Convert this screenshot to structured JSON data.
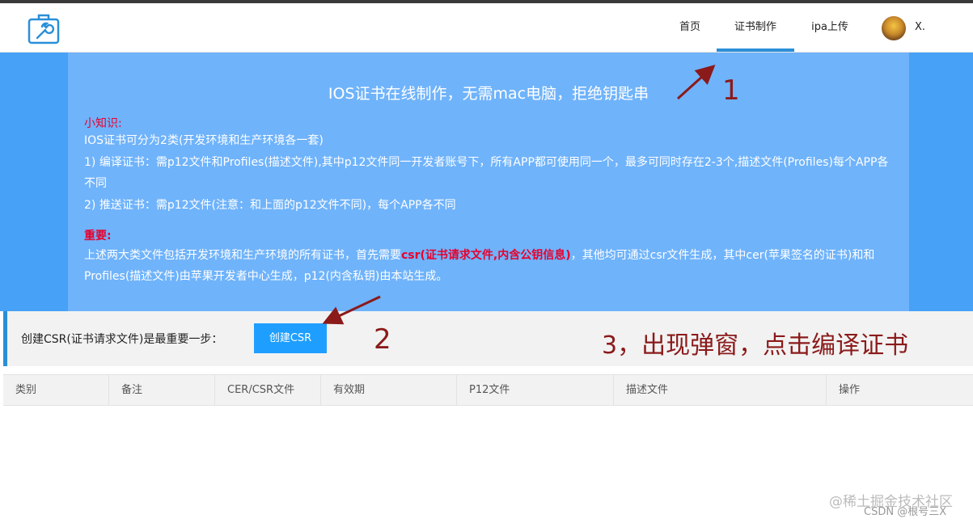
{
  "nav": {
    "logo_icon": "toolbox-wrench-icon",
    "items": [
      {
        "label": "首页",
        "active": false
      },
      {
        "label": "证书制作",
        "active": true
      },
      {
        "label": "ipa上传",
        "active": false
      }
    ],
    "user_name": "X.",
    "accent_color": "#2a8fd8"
  },
  "hero": {
    "title": "IOS证书在线制作，无需mac电脑，拒绝钥匙串",
    "tip_title": "小知识:",
    "tip_lines": [
      "IOS证书可分为2类(开发环境和生产环境各一套)",
      "1) 编译证书：需p12文件和Profiles(描述文件),其中p12文件同一开发者账号下，所有APP都可使用同一个，最多可同时存在2-3个,描述文件(Profiles)每个APP各不同",
      "2) 推送证书：需p12文件(注意：和上面的p12文件不同)，每个APP各不同"
    ],
    "important_title": "重要:",
    "important_before": "上述两大类文件包括开发环境和生产环境的所有证书，首先需要",
    "important_highlight": "csr(证书请求文件,内含公钥信息)",
    "important_after": "，其他均可通过csr文件生成，其中cer(苹果签名的证书)和和Profiles(描述文件)由苹果开发者中心生成，p12(内含私钥)由本站生成。",
    "bg_color": "#47a1f7"
  },
  "csr": {
    "label": "创建CSR(证书请求文件)是最重要一步：",
    "button_label": "创建CSR"
  },
  "annotations": {
    "one": "1",
    "two": "2",
    "three": "3，出现弹窗，点击编译证书"
  },
  "table": {
    "headers": [
      "类别",
      "备注",
      "CER/CSR文件",
      "有效期",
      "P12文件",
      "描述文件",
      "操作"
    ]
  },
  "watermark": {
    "line1": "@稀土掘金技术社区",
    "line2": "CSDN @根号三X"
  }
}
